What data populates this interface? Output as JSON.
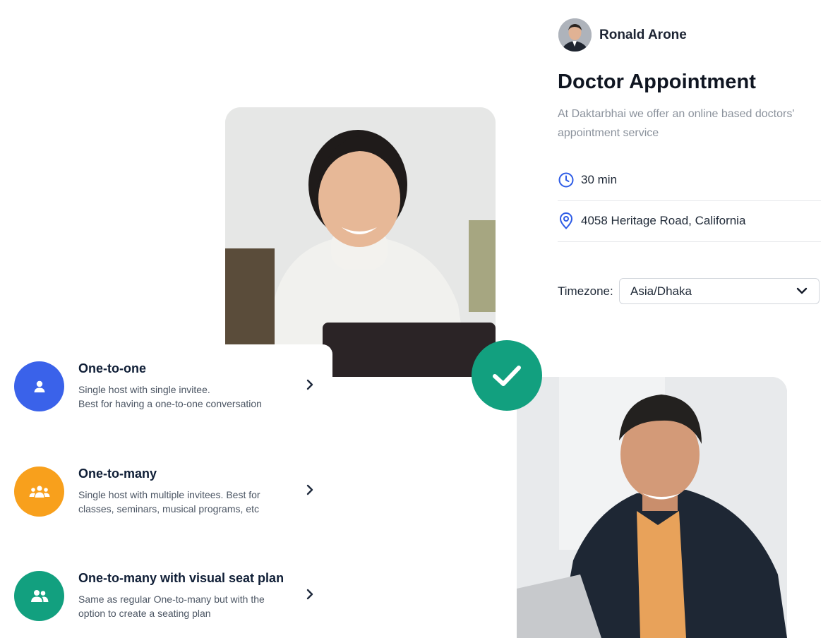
{
  "host": {
    "name": "Ronald Arone"
  },
  "appointment": {
    "title": "Doctor Appointment",
    "description": "At Daktarbhai we offer an online based doctors' appointment service",
    "duration": "30 min",
    "location": "4058 Heritage Road, California"
  },
  "timezone": {
    "label": "Timezone:",
    "selected": "Asia/Dhaka"
  },
  "event_types": [
    {
      "title": "One-to-one",
      "line1": "Single host with single invitee.",
      "line2": "Best for having a one-to-one conversation",
      "icon": "user-icon",
      "color": "#3a62ea"
    },
    {
      "title": "One-to-many",
      "line1": "Single host with multiple invitees. Best for",
      "line2": "classes, seminars, musical programs, etc",
      "icon": "group-icon",
      "color": "#f8a01c"
    },
    {
      "title": "One-to-many with visual seat plan",
      "line1": "Same as regular One-to-many but with the",
      "line2": "option to create a seating plan",
      "icon": "users-icon",
      "color": "#12a07f"
    }
  ],
  "colors": {
    "accent_blue": "#2e5ce6",
    "success": "#12a07f"
  }
}
